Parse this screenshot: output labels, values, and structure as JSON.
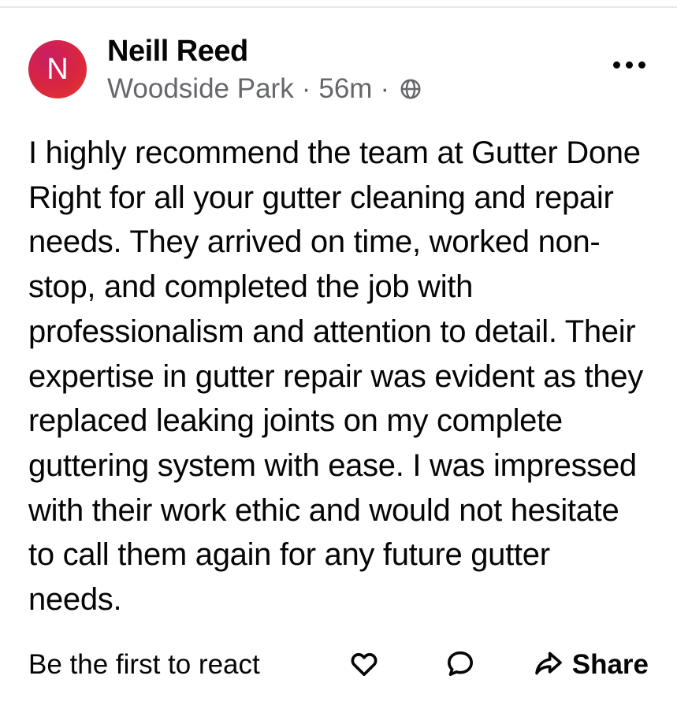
{
  "post": {
    "author": {
      "initial": "N",
      "name": "Neill Reed",
      "location": "Woodside Park",
      "time": "56m",
      "audience_icon": "globe-icon"
    },
    "menu_icon": "more-options-icon",
    "text": "I highly recommend the team at Gutter Done Right for all your gutter cleaning and repair needs. They arrived on time, worked non-stop, and completed the job with professionalism and attention to detail. Their expertise in gutter repair was evident as they replaced leaking joints on my complete guttering system with ease. I was impressed with their work ethic and would not hesitate to call them again for any future gutter needs.",
    "reactions_summary": "Be the first to react",
    "actions": {
      "like_icon": "heart-icon",
      "comment_icon": "comment-icon",
      "share_icon": "share-arrow-icon",
      "share_label": "Share"
    }
  },
  "colors": {
    "avatar": "#d9263f",
    "text_primary": "#050505",
    "text_secondary": "#65676b"
  }
}
